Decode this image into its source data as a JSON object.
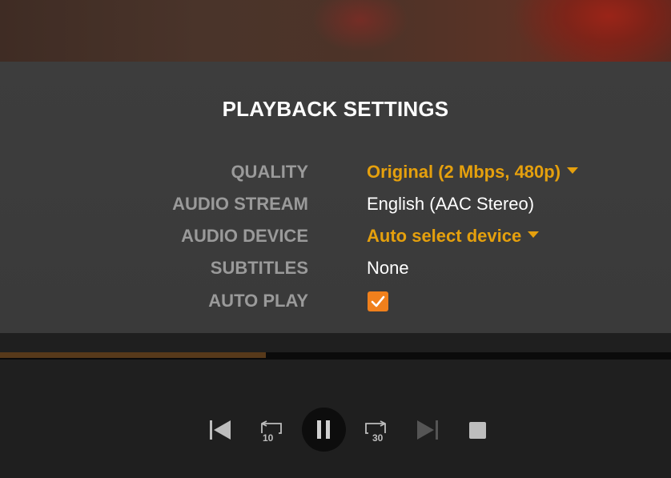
{
  "panel": {
    "title": "PLAYBACK SETTINGS",
    "rows": [
      {
        "label": "QUALITY",
        "value": "Original (2 Mbps, 480p)"
      },
      {
        "label": "AUDIO STREAM",
        "value": "English (AAC Stereo)"
      },
      {
        "label": "AUDIO DEVICE",
        "value": "Auto select device"
      },
      {
        "label": "SUBTITLES",
        "value": "None"
      },
      {
        "label": "AUTO PLAY",
        "checked": true
      }
    ]
  },
  "player": {
    "progress_fraction": 0.396,
    "replay_label": "10",
    "forward_label": "30",
    "controls": [
      "skip-previous-icon",
      "replay-10-icon",
      "pause-icon",
      "forward-30-icon",
      "skip-next-icon",
      "stop-icon"
    ]
  },
  "colors": {
    "accent": "#e5a00d",
    "checkbox": "#f0801c",
    "label": "#9a9a9a"
  }
}
